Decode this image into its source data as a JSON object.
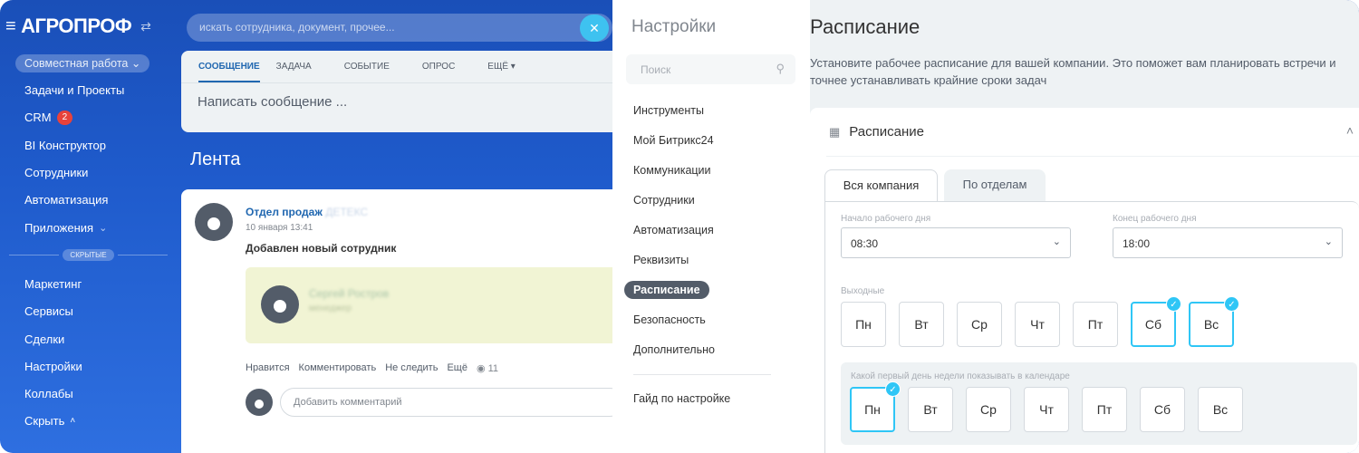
{
  "app": {
    "logo": "АГРОПРОФ",
    "search_placeholder": "искать сотрудника, документ, прочее...",
    "nav": {
      "group_label": "Совместная работа",
      "items": [
        {
          "label": "Задачи и Проекты"
        },
        {
          "label": "CRM",
          "badge": "2"
        },
        {
          "label": "BI Конструктор"
        },
        {
          "label": "Сотрудники"
        },
        {
          "label": "Автоматизация"
        },
        {
          "label": "Приложения"
        }
      ],
      "hidden_label": "СКРЫТЫЕ",
      "items_hidden": [
        {
          "label": "Маркетинг"
        },
        {
          "label": "Сервисы"
        },
        {
          "label": "Сделки"
        },
        {
          "label": "Настройки"
        },
        {
          "label": "Коллабы"
        },
        {
          "label": "Скрыть"
        }
      ]
    },
    "composer": {
      "tabs": [
        "СООБЩЕНИЕ",
        "ЗАДАЧА",
        "СОБЫТИЕ",
        "ОПРОС",
        "ЕЩЁ"
      ],
      "placeholder": "Написать сообщение ..."
    },
    "feed_title": "Лента",
    "post": {
      "author": "Отдел продаж",
      "author_blurred": "ДЕТЕКС",
      "date": "10 января 13:41",
      "text": "Добавлен новый сотрудник",
      "card_name": "Сергей Ростров",
      "card_role": "менеджер",
      "actions": [
        "Нравится",
        "Комментировать",
        "Не следить",
        "Ещё"
      ],
      "views": "11",
      "comment_placeholder": "Добавить комментарий"
    }
  },
  "settings": {
    "title": "Настройки",
    "search_placeholder": "Поиск",
    "menu": [
      "Инструменты",
      "Мой Битрикс24",
      "Коммуникации",
      "Сотрудники",
      "Автоматизация",
      "Реквизиты",
      "Расписание",
      "Безопасность",
      "Дополнительно"
    ],
    "active_item": "Расписание",
    "guide": "Гайд по настройке",
    "page": {
      "title": "Расписание",
      "description": "Установите рабочее расписание для вашей компании. Это поможет вам планировать встречи и точнее устанавливать крайние сроки задач",
      "card_title": "Расписание",
      "tab_all": "Вся компания",
      "tab_dept": "По отделам",
      "start_label": "Начало рабочего дня",
      "start_value": "08:30",
      "end_label": "Конец рабочего дня",
      "end_value": "18:00",
      "weekends_label": "Выходные",
      "weekend_days": [
        {
          "label": "Пн",
          "selected": false
        },
        {
          "label": "Вт",
          "selected": false
        },
        {
          "label": "Ср",
          "selected": false
        },
        {
          "label": "Чт",
          "selected": false
        },
        {
          "label": "Пт",
          "selected": false
        },
        {
          "label": "Сб",
          "selected": true
        },
        {
          "label": "Вс",
          "selected": true
        }
      ],
      "first_day_label": "Какой первый день недели показывать в календаре",
      "first_days": [
        {
          "label": "Пн",
          "selected": true
        },
        {
          "label": "Вт",
          "selected": false
        },
        {
          "label": "Ср",
          "selected": false
        },
        {
          "label": "Чт",
          "selected": false
        },
        {
          "label": "Пт",
          "selected": false
        },
        {
          "label": "Сб",
          "selected": false
        },
        {
          "label": "Вс",
          "selected": false
        }
      ]
    }
  },
  "colors": {
    "accent": "#2fc6f6",
    "link": "#2067b0"
  }
}
